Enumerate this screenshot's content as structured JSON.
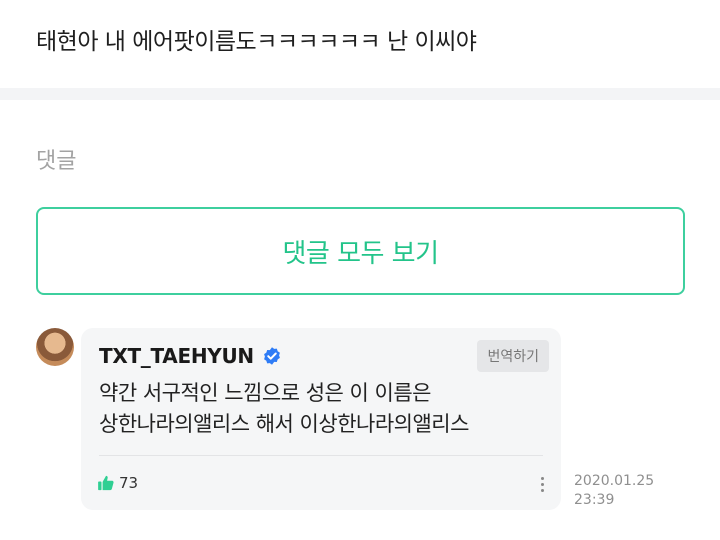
{
  "post": {
    "text": "태현아 내 에어팟이름도ㅋㅋㅋㅋㅋㅋ 난 이씨야"
  },
  "comments_section": {
    "label": "댓글",
    "view_all_label": "댓글 모두 보기"
  },
  "comment": {
    "username": "TXT_TAEHYUN",
    "verified": true,
    "translate_label": "번역하기",
    "text_line1": "약간 서구적인 느낌으로 성은 이 이름은",
    "text_line2": "상한나라의앨리스 해서 이상한나라의앨리스",
    "likes": "73",
    "date": "2020.01.25",
    "time": "23:39"
  },
  "colors": {
    "accent": "#23c48a",
    "verified": "#2e7cf6",
    "bubble_bg": "#f5f6f7"
  },
  "icons": {
    "verified": "verified-badge-icon",
    "like": "thumbs-up-icon",
    "more": "more-vertical-icon"
  }
}
